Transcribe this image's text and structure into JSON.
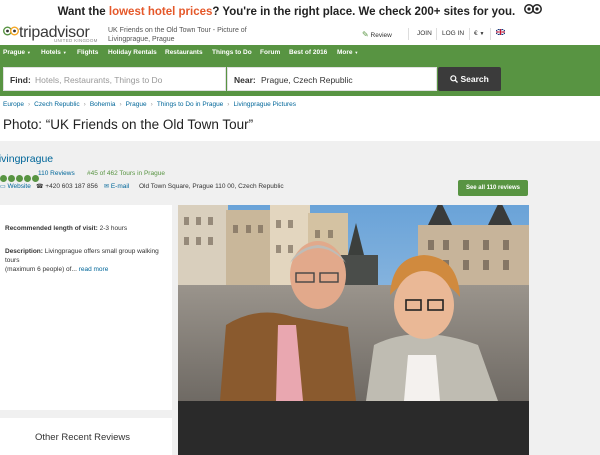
{
  "banner": {
    "pre": "Want the ",
    "highlight": "lowest hotel prices",
    "post": "? You're in the right place. We check 200+ sites for you."
  },
  "header": {
    "logo": "tripadvisor",
    "logo_sub": "UNITED KINGDOM",
    "page_title": "UK Friends on the Old Town Tour - Picture of Livingprague, Prague",
    "review": "Review",
    "join": "JOIN",
    "login": "LOG IN",
    "currency": "€"
  },
  "nav": {
    "items": [
      "Prague",
      "Hotels",
      "Flights",
      "Holiday Rentals",
      "Restaurants",
      "Things to Do",
      "Forum",
      "Best of 2016",
      "More"
    ]
  },
  "search": {
    "find_label": "Find:",
    "find_placeholder": "Hotels, Restaurants, Things to Do",
    "near_label": "Near:",
    "near_value": "Prague, Czech Republic",
    "button": "Search"
  },
  "breadcrumb": [
    "Europe",
    "Czech Republic",
    "Bohemia",
    "Prague",
    "Things to Do in Prague",
    "Livingprague Pictures"
  ],
  "photo_title": "Photo: “UK Friends on the Old Town Tour”",
  "operator": {
    "name": "Livingprague",
    "rating": 5,
    "reviews": "110 Reviews",
    "rank": "#45 of 462 Tours in Prague",
    "website": "Website",
    "phone": "+420 603 187 856",
    "email": "E-mail",
    "address": "Old Town Square, Prague 110 00, Czech Republic",
    "see_all": "See all 110 reviews"
  },
  "details": {
    "visit_label": "Recommended length of visit:",
    "visit_value": "2-3 hours",
    "desc_label": "Description:",
    "desc_text_1": "Livingprague offers small group walking tours",
    "desc_text_2": "(maximum 6 people) of...",
    "read_more": "read more"
  },
  "other_reviews": "Other Recent Reviews"
}
